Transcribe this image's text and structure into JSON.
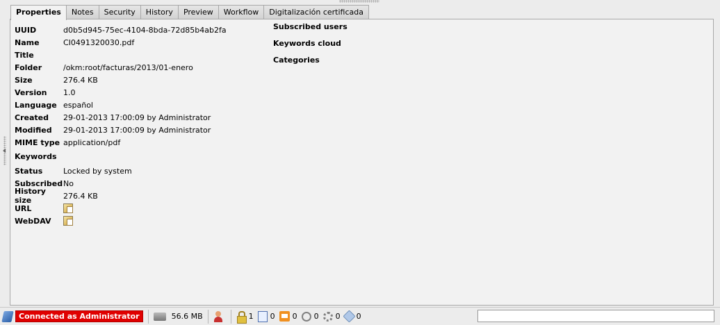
{
  "tabs": [
    {
      "label": "Properties",
      "active": true
    },
    {
      "label": "Notes",
      "active": false
    },
    {
      "label": "Security",
      "active": false
    },
    {
      "label": "History",
      "active": false
    },
    {
      "label": "Preview",
      "active": false
    },
    {
      "label": "Workflow",
      "active": false
    },
    {
      "label": "Digitalización certificada",
      "active": false
    }
  ],
  "properties": {
    "uuid": {
      "label": "UUID",
      "value": "d0b5d945-75ec-4104-8bda-72d85b4ab2fa"
    },
    "name": {
      "label": "Name",
      "value": "CI0491320030.pdf"
    },
    "title": {
      "label": "Title",
      "value": ""
    },
    "folder": {
      "label": "Folder",
      "value": "/okm:root/facturas/2013/01-enero"
    },
    "size": {
      "label": "Size",
      "value": "276.4 KB"
    },
    "version": {
      "label": "Version",
      "value": "1.0"
    },
    "language": {
      "label": "Language",
      "value": "español"
    },
    "created": {
      "label": "Created",
      "value": "29-01-2013 17:00:09 by Administrator"
    },
    "modified": {
      "label": "Modified",
      "value": "29-01-2013 17:00:09 by Administrator"
    },
    "mime": {
      "label": "MIME type",
      "value": "application/pdf"
    },
    "keywords": {
      "label": "Keywords",
      "value": ""
    },
    "status": {
      "label": "Status",
      "value": "Locked by system"
    },
    "subscribed": {
      "label": "Subscribed",
      "value": "No"
    },
    "history_size": {
      "label": "History size",
      "value": "276.4 KB"
    },
    "url": {
      "label": "URL",
      "icon": "copy-clipboard-icon"
    },
    "webdav": {
      "label": "WebDAV",
      "icon": "copy-clipboard-icon"
    }
  },
  "right": {
    "subscribed_users": "Subscribed users",
    "keywords_cloud": "Keywords cloud",
    "categories": "Categories"
  },
  "statusbar": {
    "connected": "Connected as Administrator",
    "connected_color": "#e00000",
    "disk_usage": "56.6 MB",
    "locked_count": "1",
    "checkout_count": "0",
    "messages_count": "0",
    "attachments_count": "0",
    "workflows_count": "0",
    "tags_count": "0",
    "search_value": ""
  }
}
